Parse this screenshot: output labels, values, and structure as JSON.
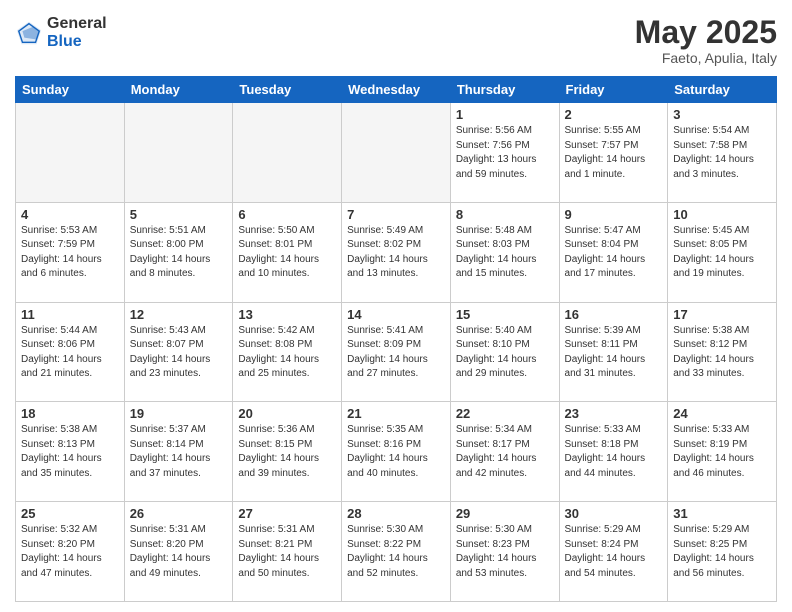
{
  "header": {
    "logo_general": "General",
    "logo_blue": "Blue",
    "title": "May 2025",
    "subtitle": "Faeto, Apulia, Italy"
  },
  "days_of_week": [
    "Sunday",
    "Monday",
    "Tuesday",
    "Wednesday",
    "Thursday",
    "Friday",
    "Saturday"
  ],
  "weeks": [
    [
      {
        "day": "",
        "empty": true
      },
      {
        "day": "",
        "empty": true
      },
      {
        "day": "",
        "empty": true
      },
      {
        "day": "",
        "empty": true
      },
      {
        "day": "1",
        "sunrise": "5:56 AM",
        "sunset": "7:56 PM",
        "daylight": "13 hours and 59 minutes."
      },
      {
        "day": "2",
        "sunrise": "5:55 AM",
        "sunset": "7:57 PM",
        "daylight": "14 hours and 1 minute."
      },
      {
        "day": "3",
        "sunrise": "5:54 AM",
        "sunset": "7:58 PM",
        "daylight": "14 hours and 3 minutes."
      }
    ],
    [
      {
        "day": "4",
        "sunrise": "5:53 AM",
        "sunset": "7:59 PM",
        "daylight": "14 hours and 6 minutes."
      },
      {
        "day": "5",
        "sunrise": "5:51 AM",
        "sunset": "8:00 PM",
        "daylight": "14 hours and 8 minutes."
      },
      {
        "day": "6",
        "sunrise": "5:50 AM",
        "sunset": "8:01 PM",
        "daylight": "14 hours and 10 minutes."
      },
      {
        "day": "7",
        "sunrise": "5:49 AM",
        "sunset": "8:02 PM",
        "daylight": "14 hours and 13 minutes."
      },
      {
        "day": "8",
        "sunrise": "5:48 AM",
        "sunset": "8:03 PM",
        "daylight": "14 hours and 15 minutes."
      },
      {
        "day": "9",
        "sunrise": "5:47 AM",
        "sunset": "8:04 PM",
        "daylight": "14 hours and 17 minutes."
      },
      {
        "day": "10",
        "sunrise": "5:45 AM",
        "sunset": "8:05 PM",
        "daylight": "14 hours and 19 minutes."
      }
    ],
    [
      {
        "day": "11",
        "sunrise": "5:44 AM",
        "sunset": "8:06 PM",
        "daylight": "14 hours and 21 minutes."
      },
      {
        "day": "12",
        "sunrise": "5:43 AM",
        "sunset": "8:07 PM",
        "daylight": "14 hours and 23 minutes."
      },
      {
        "day": "13",
        "sunrise": "5:42 AM",
        "sunset": "8:08 PM",
        "daylight": "14 hours and 25 minutes."
      },
      {
        "day": "14",
        "sunrise": "5:41 AM",
        "sunset": "8:09 PM",
        "daylight": "14 hours and 27 minutes."
      },
      {
        "day": "15",
        "sunrise": "5:40 AM",
        "sunset": "8:10 PM",
        "daylight": "14 hours and 29 minutes."
      },
      {
        "day": "16",
        "sunrise": "5:39 AM",
        "sunset": "8:11 PM",
        "daylight": "14 hours and 31 minutes."
      },
      {
        "day": "17",
        "sunrise": "5:38 AM",
        "sunset": "8:12 PM",
        "daylight": "14 hours and 33 minutes."
      }
    ],
    [
      {
        "day": "18",
        "sunrise": "5:38 AM",
        "sunset": "8:13 PM",
        "daylight": "14 hours and 35 minutes."
      },
      {
        "day": "19",
        "sunrise": "5:37 AM",
        "sunset": "8:14 PM",
        "daylight": "14 hours and 37 minutes."
      },
      {
        "day": "20",
        "sunrise": "5:36 AM",
        "sunset": "8:15 PM",
        "daylight": "14 hours and 39 minutes."
      },
      {
        "day": "21",
        "sunrise": "5:35 AM",
        "sunset": "8:16 PM",
        "daylight": "14 hours and 40 minutes."
      },
      {
        "day": "22",
        "sunrise": "5:34 AM",
        "sunset": "8:17 PM",
        "daylight": "14 hours and 42 minutes."
      },
      {
        "day": "23",
        "sunrise": "5:33 AM",
        "sunset": "8:18 PM",
        "daylight": "14 hours and 44 minutes."
      },
      {
        "day": "24",
        "sunrise": "5:33 AM",
        "sunset": "8:19 PM",
        "daylight": "14 hours and 46 minutes."
      }
    ],
    [
      {
        "day": "25",
        "sunrise": "5:32 AM",
        "sunset": "8:20 PM",
        "daylight": "14 hours and 47 minutes."
      },
      {
        "day": "26",
        "sunrise": "5:31 AM",
        "sunset": "8:20 PM",
        "daylight": "14 hours and 49 minutes."
      },
      {
        "day": "27",
        "sunrise": "5:31 AM",
        "sunset": "8:21 PM",
        "daylight": "14 hours and 50 minutes."
      },
      {
        "day": "28",
        "sunrise": "5:30 AM",
        "sunset": "8:22 PM",
        "daylight": "14 hours and 52 minutes."
      },
      {
        "day": "29",
        "sunrise": "5:30 AM",
        "sunset": "8:23 PM",
        "daylight": "14 hours and 53 minutes."
      },
      {
        "day": "30",
        "sunrise": "5:29 AM",
        "sunset": "8:24 PM",
        "daylight": "14 hours and 54 minutes."
      },
      {
        "day": "31",
        "sunrise": "5:29 AM",
        "sunset": "8:25 PM",
        "daylight": "14 hours and 56 minutes."
      }
    ]
  ],
  "labels": {
    "sunrise": "Sunrise:",
    "sunset": "Sunset:",
    "daylight": "Daylight:"
  }
}
